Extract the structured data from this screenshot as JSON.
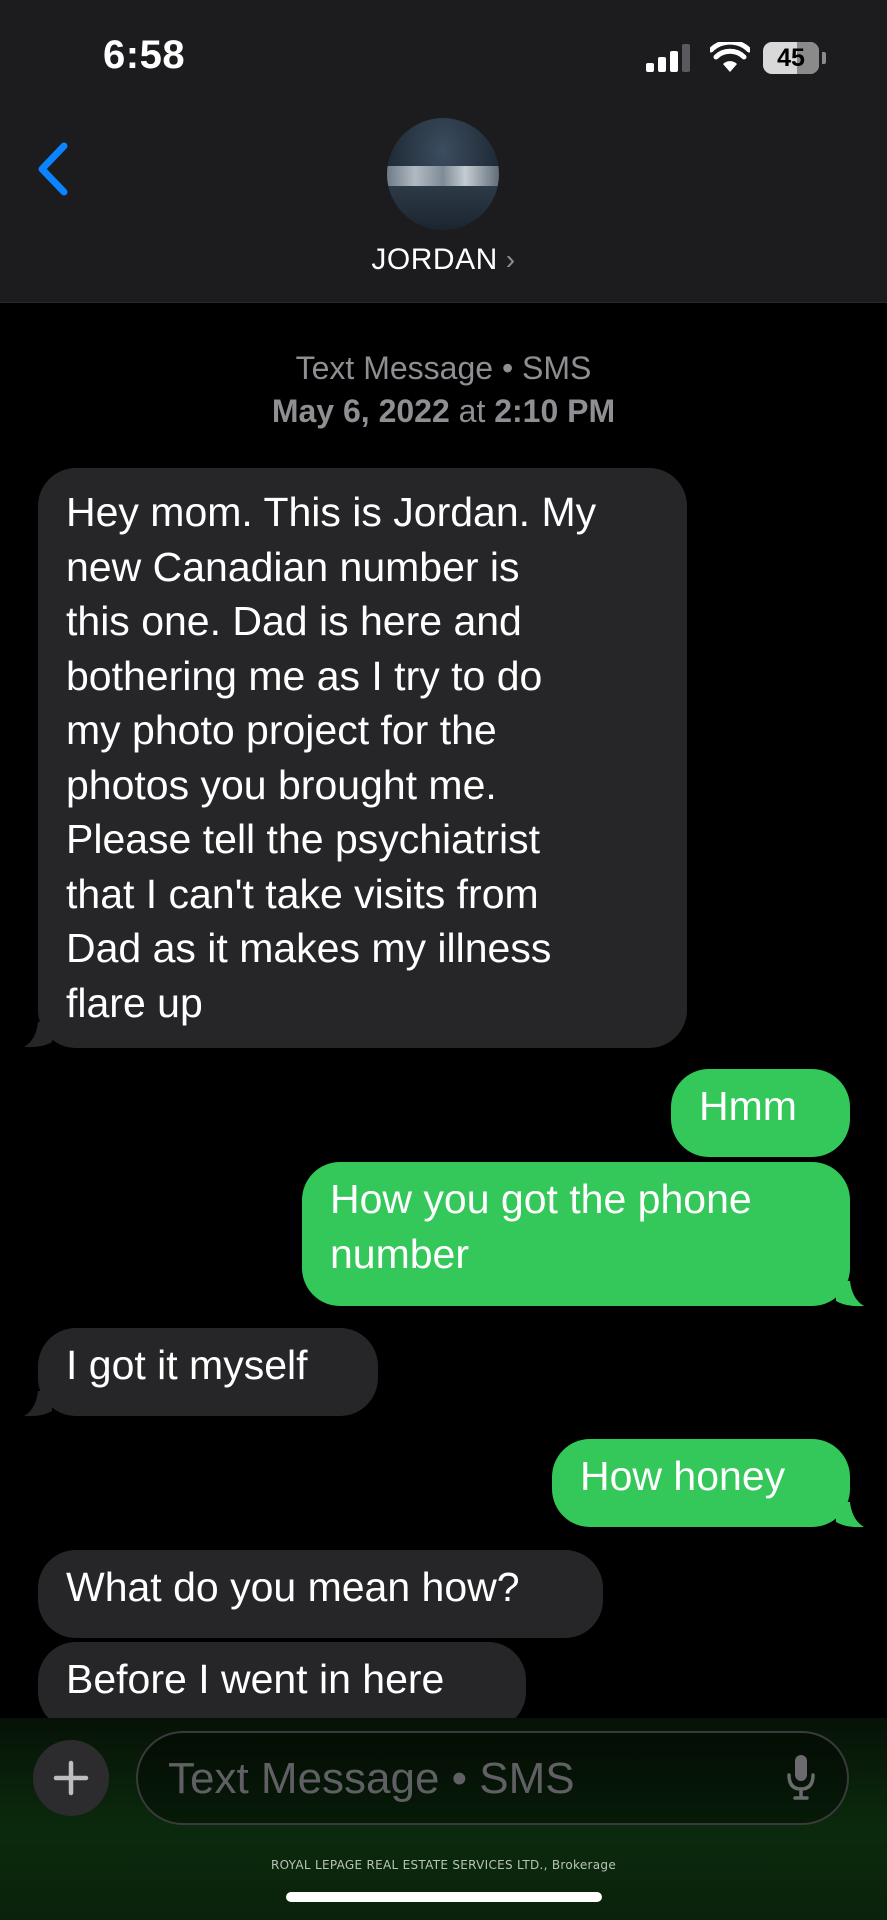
{
  "status_bar": {
    "time": "6:58",
    "battery": "45"
  },
  "header": {
    "contact_name": "JORDAN",
    "chevron": "›"
  },
  "thread_meta": {
    "service": "Text Message • SMS",
    "date": "May 6, 2022",
    "at": "at",
    "time": "2:10 PM"
  },
  "messages": [
    {
      "direction": "incoming",
      "lines": [
        "Hey mom. This is Jordan. My",
        "new Canadian number is",
        "this one. Dad is here and",
        "bothering me as I try to do",
        "my photo project for the",
        "photos you brought me.",
        "Please tell the psychiatrist",
        "that I can't take visits from",
        "Dad as it makes my illness",
        "flare up"
      ]
    },
    {
      "direction": "outgoing",
      "lines": [
        "Hmm"
      ]
    },
    {
      "direction": "outgoing",
      "lines": [
        "How you got the phone",
        "number"
      ]
    },
    {
      "direction": "incoming",
      "lines": [
        "I got it myself"
      ]
    },
    {
      "direction": "outgoing",
      "lines": [
        "How honey"
      ]
    },
    {
      "direction": "incoming",
      "lines": [
        "What do you mean how?"
      ]
    },
    {
      "direction": "incoming",
      "lines": [
        "Before I went in here"
      ]
    }
  ],
  "compose": {
    "plus": "+",
    "placeholder": "Text Message • SMS"
  },
  "footer": {
    "text": "ROYAL LEPAGE REAL ESTATE SERVICES LTD., Brokerage"
  },
  "colors": {
    "incoming_bubble": "#262629",
    "outgoing_bubble": "#34c759",
    "accent": "#0a84ff"
  },
  "icons": {
    "back": "chevron-left-icon",
    "signal": "signal-icon",
    "wifi": "wifi-icon",
    "battery": "battery-icon",
    "mic": "microphone-icon",
    "plus": "plus-icon"
  }
}
